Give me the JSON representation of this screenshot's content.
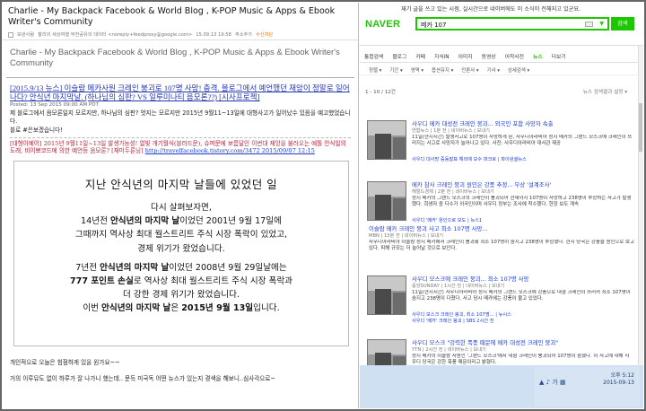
{
  "mail": {
    "header_title": "Charlie - My Backpack Facebook & World Blog , K-POP Music & Apps & Ebook Writer's Community",
    "toolbar": {
      "sender_label": "보낸사람",
      "sender": "찰리의 세상여행 무한공유의 데이터 <noreply+feedproxy@google.com>",
      "time": "15.09.13 19:58",
      "address_add": "주소추가",
      "block": "수신차단"
    },
    "subject": "Charlie - My Backpack Facebook & World Blog , K-POP Music & Apps & Ebook Writer's Community",
    "post_title": "[2015.9/13 뉴스] 이슬람 메카사원 크레인 붕괴로 107명 사망! 충격. 블로그에서 예언했던 재앙이 정말로 일어나다? 안식년 마지막날. (하나님의 심판? VS 일루미나티 음모론??) [시사프로젝]",
    "posted": "Posted: 13 Sep 2015 09:00 AM PDT",
    "intro": "제 블로그에서 음모론일지 모르지만, 하나님의 심판? 엇지는 모르지만 2015년 9월11~13일에 대형사고가 일어났수 있음을 예고했었습니다.",
    "intro2": "블로 #은보겠습니다!",
    "quote": "[대형이예어] 2015년 9월11일~13일 발생가능성! 얼빛 개기월식(블러드문), 슈퍼문에 보름달인 이번대 재앙을 불러오는 예톨 안식일의 도래, 비이뽀코드에 의한 예언등 음모론? [재미두론닝]",
    "quote_url": "http://travelfacebook.tistory.com/3472 2015/09/07 12:15",
    "card": {
      "heading": "지난 안식년의 마지막 날들에 있었던 일",
      "line1": "다시 살펴보자면,",
      "line2_a": "14년전 ",
      "line2_b": "안식년의 마지막 날",
      "line2_c": "이었던 2001년 9월 17일",
      "line2_d": "에",
      "line3": "그때까지 역사상 최대 월스트리트 주식 시장 폭락이 있었고,",
      "line4": "경제 위기가 왔었습니다.",
      "line5_a": "7년전 ",
      "line5_b": "안식년의 마지막 날",
      "line5_c": "이었던 2008년 9월 29일날에는",
      "line6_a": "777 포인트 손실",
      "line6_b": "로 역사상 최대 월스트리트 주식 시장 폭락과",
      "line7": "더 강한 경제 위기가 왔었습니다.",
      "line8_a": "이번 ",
      "line8_b": "안식년의 마지막 날",
      "line8_c": "은 ",
      "line8_d": "2015년 9월 13일",
      "line8_e": "입니다."
    },
    "footer1": "개인적으로 오늘은 힘점하게 있을 원가요~~",
    "footer2": "거의 이루뮤도 없이 하루가 잘 나가니 했는데.. 문득 미국독 어떤 뉴스가 있는지 경색을 해보니..심사각으로~"
  },
  "naver": {
    "notice": "재기 글을 쓰고 있는 시점, 실시간으로 네이버에도 이 소식이 전해지고 있군요.",
    "logo": "NAVER",
    "query": "메카 107",
    "search_button": "검색",
    "tabs": [
      "통합검색",
      "블로그",
      "카페",
      "지식iN",
      "이미지",
      "동영상",
      "어학사전",
      "뉴스",
      "더보기"
    ],
    "active_tab": "뉴스",
    "filters": [
      "정렬 ▾",
      "기간 ▾",
      "영역 ▾",
      "옵션유지 ▾",
      "언론사 ▾",
      "기사 ▾",
      "상세검색 ▾"
    ],
    "count": "1 - 10 / 12건",
    "count_right": "뉴스 검색결과 설정 ▾",
    "items": [
      {
        "title": "사우디 메카 대성전 크레인 붕괴... 외국인 포함 사망자 속출",
        "meta": "연합뉴스 | 1분 전 | 네이버뉴스 | 보내기",
        "desc": "11일(현지시간) 발생사고로 107명이 사망하게 된, 사우디아라비아 성지 메카의 그랜드 모스크에 크레인이 쓰러지는 사고로 사망자가 늘어나고 있다. 사진: 사우디아라비아 대사관 제공",
        "sub1": "사우디 대사망 중동발표 해외에 보수 파크로 | 파이낸셜뉴스"
      },
      {
        "title": "메카 참사 크레인 붕괴 원인은 강풍 추정... 부상 '설계조사'",
        "meta": "헤럴드경제 | 2분 전 | 네이버뉴스 | 보내기",
        "desc": "성지 메카의 그랜드 모스크의 크레인이 붕괴되어 현재까지 107명이 사망하고 238명이 부상하는 사고가 발생했다. 희생자 중 다수가 외국인이며 사우디 정부는 조사에 착수했다. 현장 보도 계속",
        "sub1": "사우디 '메카' 원인으로 보도 | 뉴스1"
      },
      {
        "title": "이슬람 메카 크레인 붕괴 사고 최소 107명 사망...",
        "meta": "MBN | 15분 전 | 네이버뉴스 | 보내기",
        "desc": "사우디아라비아 이슬람 성지 메카에서 크레인이 붕괴돼 최소 107명이 숨지고 238명이 부상했다. 현지 당국은 강풍을 원인으로 보고 있다. 피해 규모는 더 늘어날 것으로 보인다.",
        "sub1": "이슬람 메카서 크레인 붕괴... 최소 107명 사망 | 노컷뉴스"
      },
      {
        "title": "사우디 모스크에 크레인 붕괴... 최소 107명 사망",
        "meta": "중앙SUNDAY | 1시간 전 | 네이버뉴스 | 보내기",
        "desc": "11일(현지시간) 사우디아라비아 성지 메카의 그랜드 모스크에 강풍으로 대형 크레인이 쓰러져 최소 107명이 숨지고 238명이 다쳤다. 사고 당시 메카에는 강풍이 불고 있었다.",
        "sub1": "사우디 모스크 크레인 붕괴, 최소 107명... | 뉴시스",
        "sub2": "사우디 '메카' 크레인 붕괴 | SBS 2시간 전"
      },
      {
        "title": "사우디 모스크 \"강력한 폭풍 때문에 메카 대성전 크레인 붕괴\"",
        "meta": "YTN | 2시간 전 | 네이버뉴스 | 보내기",
        "desc": "성지 메카의 이슬람 사원인 '그랜드 모스크'에서 대형 크레인이 붕괴되어 107명이 숨졌다. 이 사고에 대해 사우디 당국은 강한 폭풍 때문이라고 밝혔다."
      }
    ],
    "taskbar": {
      "tray_icons": "▲ ♪ 가 ▦",
      "time": "오후 5:12",
      "date": "2015-09-13"
    }
  }
}
